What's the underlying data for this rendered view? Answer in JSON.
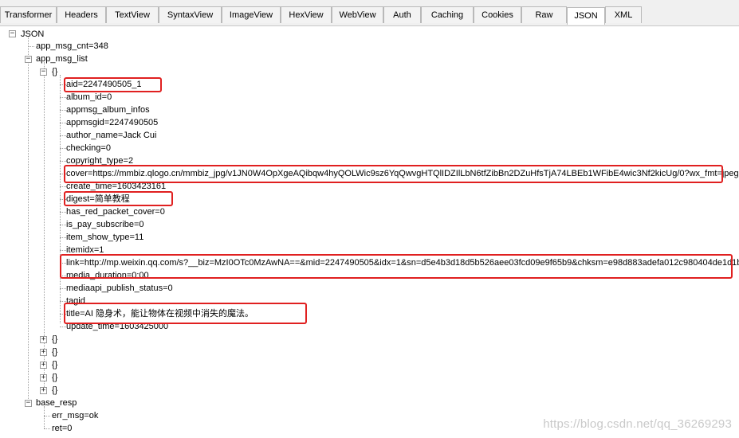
{
  "tabs": [
    "Transformer",
    "Headers",
    "TextView",
    "SyntaxView",
    "ImageView",
    "HexView",
    "WebView",
    "Auth",
    "Caching",
    "Cookies",
    "Raw",
    "JSON",
    "XML"
  ],
  "active_tab": "JSON",
  "tree": {
    "root": "JSON",
    "app_msg_cnt": "app_msg_cnt=348",
    "app_msg_list": "app_msg_list",
    "item_label": "{}",
    "fields": [
      "aid=2247490505_1",
      "album_id=0",
      "appmsg_album_infos",
      "appmsgid=2247490505",
      "author_name=Jack Cui",
      "checking=0",
      "copyright_type=2",
      "cover=https://mmbiz.qlogo.cn/mmbiz_jpg/v1JN0W4OpXgeAQibqw4hyQOLWic9sz6YqQwvgHTQlIDZIlLbN6tfZibBn2DZuHfsTjA74LBEb1WFibE4wic3Nf2kicUg/0?wx_fmt=jpeg",
      "create_time=1603423161",
      "digest=简单教程",
      "has_red_packet_cover=0",
      "is_pay_subscribe=0",
      "item_show_type=11",
      "itemidx=1",
      "link=http://mp.weixin.qq.com/s?__biz=MzI0OTc0MzAwNA==&mid=2247490505&idx=1&sn=d5e4b3d18d5b526aee03fcd09e9f65b9&chksm=e98d883adefa012c980404de1d1b",
      "media_duration=0:00",
      "mediaapi_publish_status=0",
      "tagid",
      "title=AI 隐身术，能让物体在视频中消失的魔法。",
      "update_time=1603425000"
    ],
    "collapsed_items": [
      "{}",
      "{}",
      "{}",
      "{}",
      "{}"
    ],
    "base_resp": "base_resp",
    "base_resp_fields": [
      "err_msg=ok",
      "ret=0"
    ]
  },
  "watermark": "https://blog.csdn.net/qq_36269293",
  "colors": {
    "highlight": "#e02020",
    "tree_line": "#a0a0a0"
  }
}
